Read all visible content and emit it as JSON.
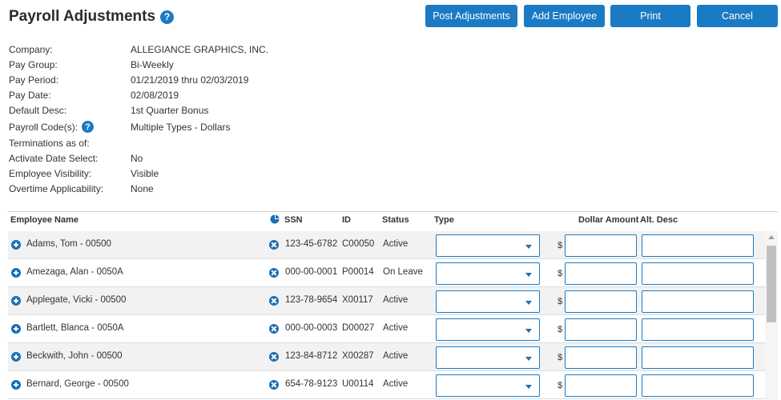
{
  "header": {
    "title": "Payroll Adjustments",
    "help_glyph": "?",
    "buttons": {
      "post": "Post Adjustments",
      "add": "Add Employee",
      "print": "Print",
      "cancel": "Cancel"
    }
  },
  "info": [
    {
      "label": "Company:",
      "value": "ALLEGIANCE GRAPHICS, INC."
    },
    {
      "label": "Pay Group:",
      "value": "Bi-Weekly"
    },
    {
      "label": "Pay Period:",
      "value": "01/21/2019 thru 02/03/2019"
    },
    {
      "label": "Pay Date:",
      "value": "02/08/2019"
    },
    {
      "label": "Default Desc:",
      "value": "1st Quarter Bonus"
    },
    {
      "label": "Payroll Code(s):",
      "value": "Multiple Types - Dollars"
    },
    {
      "label": "Terminations as of:",
      "value": ""
    },
    {
      "label": "Activate Date Select:",
      "value": "No"
    },
    {
      "label": "Employee Visibility:",
      "value": "Visible"
    },
    {
      "label": "Overtime Applicability:",
      "value": "None"
    }
  ],
  "table": {
    "headers": {
      "name": "Employee Name",
      "ssn": "SSN",
      "id": "ID",
      "status": "Status",
      "type": "Type",
      "amount": "Dollar Amount",
      "alt": "Alt. Desc"
    },
    "currency_symbol": "$",
    "rows": [
      {
        "name": "Adams, Tom - 00500",
        "ssn": "123-45-6782",
        "id": "C00050",
        "status": "Active"
      },
      {
        "name": "Amezaga, Alan - 0050A",
        "ssn": "000-00-0001",
        "id": "P00014",
        "status": "On Leave"
      },
      {
        "name": "Applegate, Vicki - 00500",
        "ssn": "123-78-9654",
        "id": "X00117",
        "status": "Active"
      },
      {
        "name": "Bartlett, Blanca - 0050A",
        "ssn": "000-00-0003",
        "id": "D00027",
        "status": "Active"
      },
      {
        "name": "Beckwith, John - 00500",
        "ssn": "123-84-8712",
        "id": "X00287",
        "status": "Active"
      },
      {
        "name": "Bernard, George - 00500",
        "ssn": "654-78-9123",
        "id": "U00114",
        "status": "Active"
      }
    ]
  },
  "colors": {
    "accent": "#1a7ac4",
    "row_alt": "#f2f2f2"
  }
}
